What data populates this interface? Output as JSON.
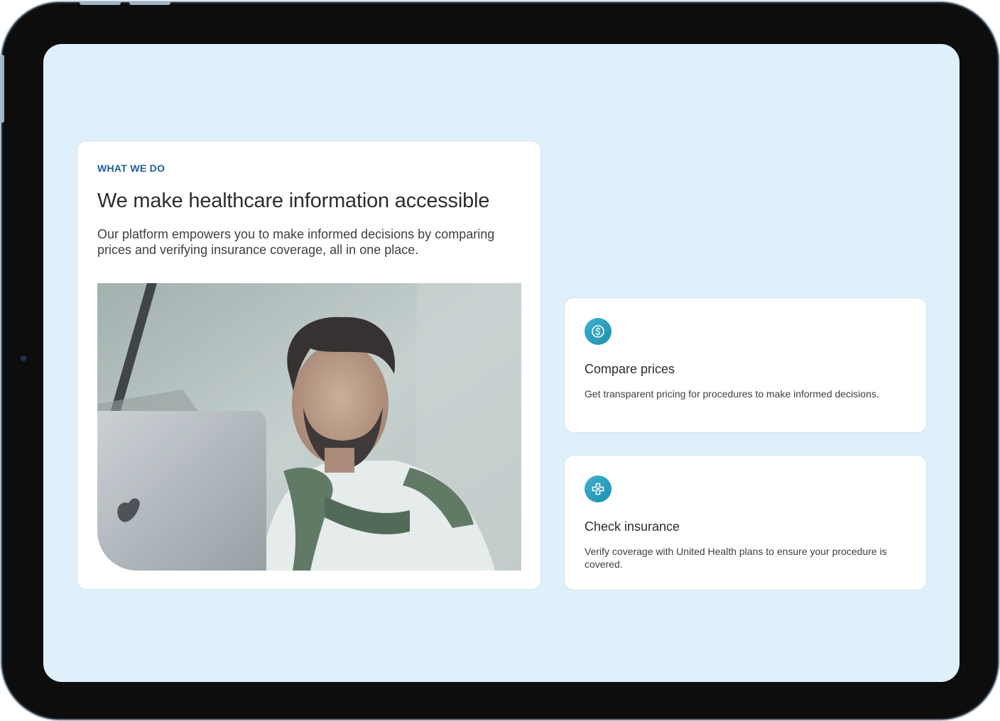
{
  "about": {
    "eyebrow": "WHAT WE DO",
    "headline": "We make healthcare information accessible",
    "intro": "Our platform empowers you to make informed decisions by comparing prices and verifying insurance coverage, all in one place."
  },
  "features": [
    {
      "icon": "dollar-circle-icon",
      "title": "Compare prices",
      "description": "Get transparent pricing for procedures to make informed decisions."
    },
    {
      "icon": "medical-cross-icon",
      "title": "Check insurance",
      "description": "Verify coverage with United Health plans to ensure your procedure is covered."
    }
  ],
  "colors": {
    "screen_background": "#dff0fb",
    "eyebrow": "#1f5f99",
    "icon_gradient_start": "#3fb2cf",
    "icon_gradient_end": "#1d8fae",
    "heading_text": "#2b2d31"
  }
}
